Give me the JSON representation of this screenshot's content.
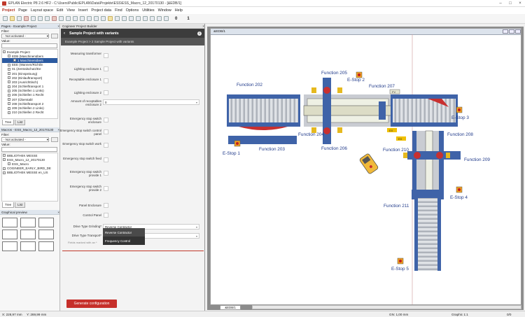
{
  "window": {
    "title": "EPLAN Electric P8 2.6 HF2 - C:\\Users\\Public\\EPLAN\\Data\\Projekte\\ESS\\ESS_Macro_12_20170130 - [&EDB/1]"
  },
  "menu": [
    "Project",
    "Page",
    "Layout space",
    "Edit",
    "View",
    "Insert",
    "Project data",
    "Find",
    "Options",
    "Utilities",
    "Window",
    "Help"
  ],
  "toolbar": {
    "num1": "0",
    "num2": "1"
  },
  "pages_panel": {
    "header": "Pages - Example Project",
    "filter_label": "Filter:",
    "filter_value": "- Not activated -",
    "value_label": "Value:",
    "items": [
      "Example Project",
      "EDB (Maschinenübers",
      "1 Maschinenübers",
      "EEE (Wannen/Richtlin",
      "01 (Zentralschutz/Ee",
      "201 (Einspeisung)",
      "202 (Einlauftransport)",
      "203 (Ausrichttisch)",
      "204 (Schleiftransport 1",
      "205 (Schleifen 1 Links)",
      "206 (Schleifen 1 Recht",
      "207 (Überstabl",
      "208 (Schleiftransport 2",
      "209 (Schleifen 2 Links)",
      "210 (Schleifen 2 Recht"
    ],
    "tabs": [
      "Tree",
      "List"
    ]
  },
  "macros_panel": {
    "header": "Macros - ESS_Macro_12_20170130",
    "filter_label": "Filter:",
    "filter_value": "- Not activated -",
    "value_label": "Value:",
    "items": [
      "BIBLIOTHEK MESSE",
      "ESS_Macro_12_20170130",
      "ESS_Macro",
      "COGINEER_EARLY_BIRD_DE",
      "BIBLIOTHEK MESSE en_US"
    ],
    "tabs": [
      "Tree",
      "List"
    ]
  },
  "graphical_preview": {
    "header": "Graphical preview"
  },
  "builder": {
    "header": "Cogineer Project Builder",
    "title": "Sample Project with variants",
    "breadcrumb": "Example Project  >  2 Sample Project with variants",
    "fields": [
      {
        "label": "Measuring transformer",
        "type": "check"
      },
      {
        "label": "Lighting enclosure 1",
        "type": "check"
      },
      {
        "label": "Receptable enclosure 1",
        "type": "check"
      },
      {
        "label": "Lighting enclosure 2",
        "type": "check"
      },
      {
        "label": "Amount of receptables enclosure 2",
        "type": "select",
        "value": "0"
      },
      {
        "label": "Emergency stop switch enclosure",
        "type": "check"
      },
      {
        "label": "Emergency stop switch control panel",
        "type": "check"
      },
      {
        "label": "Emergency stop switch work",
        "type": "check"
      },
      {
        "label": "Emergency stop switch feed",
        "type": "check"
      },
      {
        "label": "Emergency stop switch provide 1",
        "type": "check"
      },
      {
        "label": "Emergency stop switch provide 2",
        "type": "check"
      },
      {
        "label": "Panel Enclosure",
        "type": "check"
      },
      {
        "label": "Control Panel",
        "type": "check"
      },
      {
        "label": "Drive Type Grinding*",
        "type": "select",
        "value": "Reverse Contractor"
      },
      {
        "label": "Drive Type Transport*",
        "type": "select",
        "value": ""
      }
    ],
    "dropdown_options": [
      "Reverse Contractor",
      "Frequency Control"
    ],
    "hint": "Fields marked with an *",
    "generate_label": "Generate configuration"
  },
  "document": {
    "tab_label": "&EDB/1",
    "page_tab": "&EDB/1",
    "functions": [
      "Function 202",
      "Function 203",
      "Function 204",
      "Function 205",
      "Function 206",
      "Function 207",
      "Function 208",
      "Function 209",
      "Function 210",
      "Function 211"
    ],
    "estops": [
      "E-Stop 1",
      "E-Stop 2",
      "E-Stop 3",
      "E-Stop 4",
      "E-Stop 5"
    ],
    "tags": [
      "FV",
      "EX",
      "EX"
    ]
  },
  "status": {
    "x": "X: 228,97 mm",
    "y": "Y: 269,99 mm",
    "gn": "GN: 1,00 mm",
    "graphic": "Graphic 1:1",
    "zoom": "0/0"
  },
  "colors": {
    "accent": "#c62f2a",
    "blue_frame": "#3f63a8",
    "roller": "#c9ccd2",
    "estop_box": "#f0a020"
  }
}
